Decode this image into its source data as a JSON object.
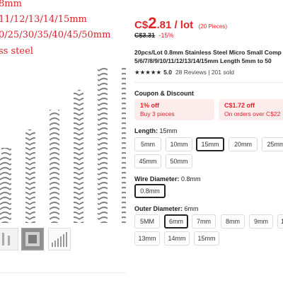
{
  "gallery": {
    "caption_lines": [
      "8mm",
      "11/12/13/14/15mm",
      "0/25/30/35/40/45/50mm",
      "ss steel"
    ]
  },
  "price": {
    "currency": "C$",
    "integer": "2",
    "decimal": ".81",
    "unit": " / lot",
    "pieces": "(20 Pieces)",
    "old_price": "C$3.31",
    "discount": "-15%"
  },
  "product": {
    "title_line1": "20pcs/Lot 0.8mm Stainless Steel Micro Small Comp",
    "title_line2": "5/6/7/8/9/10/11/12/13/14/15mm Length 5mm to 50"
  },
  "rating": {
    "stars": "★★★★★",
    "value": "5.0",
    "reviews": "28 Reviews",
    "separator": " | ",
    "sold": "201 sold"
  },
  "coupons": {
    "title": "Coupon & Discount",
    "items": [
      {
        "big": "1% off",
        "small": "Buy 3 pieces"
      },
      {
        "big": "C$1.72 off",
        "small": "On orders over C$22"
      }
    ]
  },
  "length": {
    "label": "Length: ",
    "value": "15mm",
    "options": [
      "5mm",
      "10mm",
      "15mm",
      "20mm",
      "25mm",
      "45mm",
      "50mm"
    ],
    "selected": "15mm"
  },
  "wire": {
    "label": "Wire Diameter: ",
    "value": "0.8mm",
    "options": [
      "0.8mm"
    ],
    "selected": "0.8mm"
  },
  "outer": {
    "label": "Outer Diameter: ",
    "value": "6mm",
    "options": [
      "5MM",
      "6mm",
      "7mm",
      "8mm",
      "9mm",
      "1",
      "13mm",
      "14mm",
      "15mm"
    ],
    "selected": "6mm"
  },
  "colors": {
    "accent": "#e0242a",
    "coupon_bg": "#fdecec",
    "caption_red": "#d9222a"
  }
}
